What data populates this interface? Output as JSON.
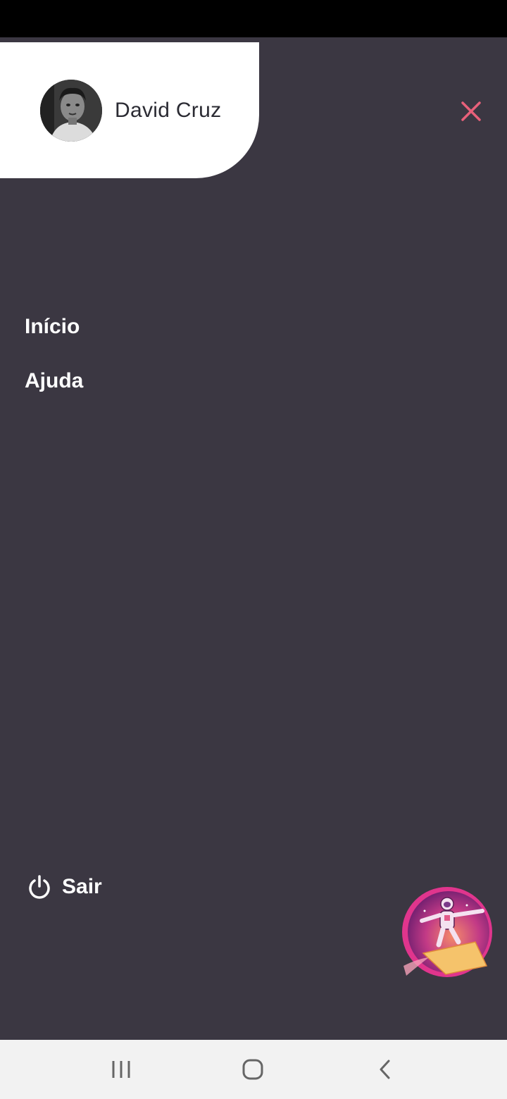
{
  "profile": {
    "name": "David Cruz"
  },
  "menu": {
    "items": [
      {
        "label": "Início"
      },
      {
        "label": "Ajuda"
      }
    ]
  },
  "logout": {
    "label": "Sair"
  },
  "icons": {
    "close": "close-icon",
    "logout": "power-icon",
    "recents": "recents-icon",
    "home": "home-icon",
    "back": "back-icon"
  },
  "colors": {
    "background": "#3b3742",
    "card": "#ffffff",
    "accent": "#e8607a",
    "text_dark": "#2b2b33",
    "text_light": "#ffffff",
    "nav_bar": "#f2f2f2"
  }
}
